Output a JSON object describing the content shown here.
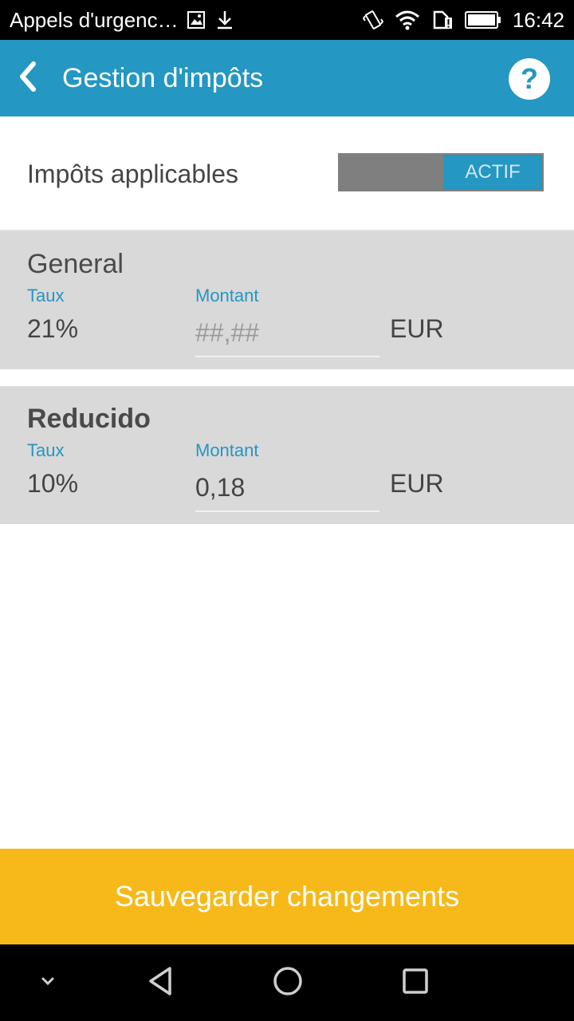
{
  "status_bar": {
    "carrier": "Appels d'urgenc…",
    "time": "16:42",
    "icons": [
      "image-icon",
      "download-icon",
      "vibrate-icon",
      "wifi-icon",
      "sim-alert-icon",
      "battery-icon"
    ]
  },
  "app_bar": {
    "title": "Gestion d'impôts",
    "help_label": "?"
  },
  "tax_toggle": {
    "label": "Impôts applicables",
    "state": "ACTIF",
    "on": true
  },
  "taxes": [
    {
      "name": "General",
      "rate_label": "Taux",
      "rate": "21%",
      "amount_label": "Montant",
      "amount_value": "",
      "amount_placeholder": "##,##",
      "currency": "EUR"
    },
    {
      "name": "Reducido",
      "rate_label": "Taux",
      "rate": "10%",
      "amount_label": "Montant",
      "amount_value": "0,18",
      "amount_placeholder": "##,##",
      "currency": "EUR"
    }
  ],
  "save_button": {
    "label": "Sauvegarder changements"
  },
  "nav_bar": {
    "icons": [
      "chevron-down-icon",
      "back-icon",
      "home-icon",
      "recents-icon"
    ]
  },
  "colors": {
    "primary": "#2497c2",
    "accent": "#f7b91a",
    "card_bg": "#d9d9d9",
    "toggle_off": "#7f7f7f"
  }
}
